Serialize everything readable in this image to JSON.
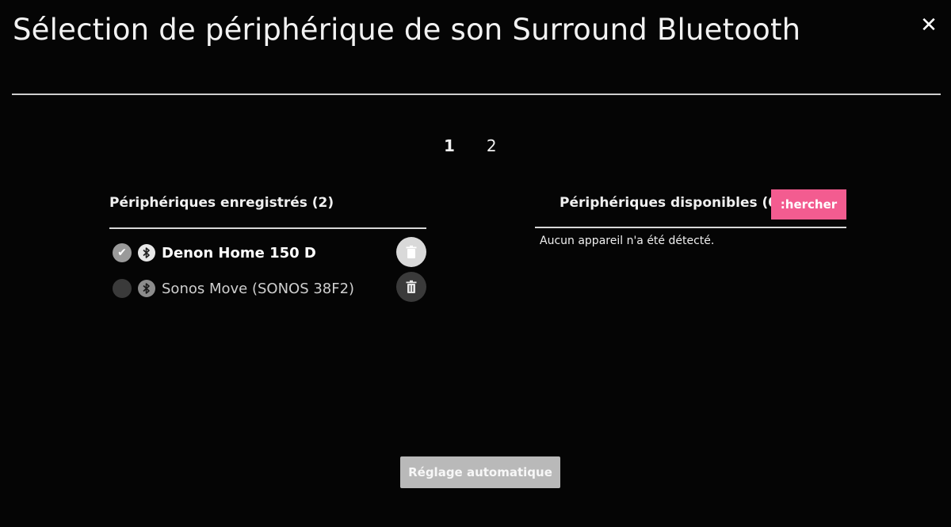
{
  "header": {
    "title": "Sélection de périphérique de son Surround Bluetooth",
    "close_label": "✕"
  },
  "pager": {
    "pages": [
      "1",
      "2"
    ],
    "current": "1"
  },
  "registered": {
    "title": "Périphériques enregistrés (2)",
    "devices": [
      {
        "name": "Denon Home 150 D",
        "selected": true
      },
      {
        "name": "Sonos Move (SONOS 38F2)",
        "selected": false
      }
    ]
  },
  "available": {
    "title": "Périphériques disponibles (0)",
    "search_label": ":hercher",
    "empty_message": "Aucun appareil n'a été détecté."
  },
  "footer": {
    "auto_label": "Réglage automatique"
  },
  "colors": {
    "background": "#050505",
    "accent": "#f35c90",
    "button_gray": "#b9b9b9"
  },
  "icons": {
    "check": "check-icon",
    "bluetooth": "bluetooth-icon",
    "trash": "trash-icon",
    "close": "close-icon"
  }
}
